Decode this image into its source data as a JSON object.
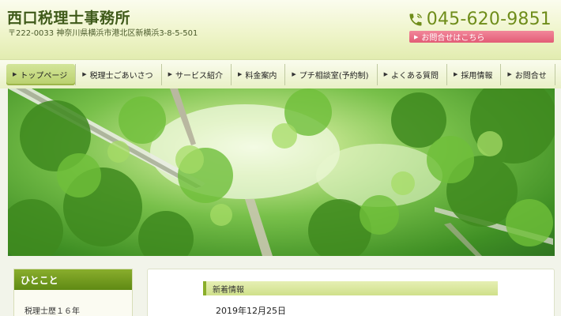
{
  "header": {
    "site_title": "西口税理士事務所",
    "address": "〒222-0033 神奈川県横浜市港北区新横浜3-8-5-501",
    "phone": "045-620-9851",
    "contact_button": "お問合せはこちら"
  },
  "nav": {
    "items": [
      {
        "label": "トップページ"
      },
      {
        "label": "税理士ごあいさつ"
      },
      {
        "label": "サービス紹介"
      },
      {
        "label": "料金案内"
      },
      {
        "label": "プチ相談室(予約制)"
      },
      {
        "label": "よくある質問"
      },
      {
        "label": "採用情報"
      },
      {
        "label": "お問合せ"
      }
    ]
  },
  "sidebar": {
    "heading": "ひとこと",
    "text": "税理士歴１６年"
  },
  "main": {
    "news_heading": "新着情報",
    "news_date": "2019年12月25日"
  },
  "colors": {
    "accent_green": "#6f8d1a",
    "contact_pink": "#e25c76"
  }
}
